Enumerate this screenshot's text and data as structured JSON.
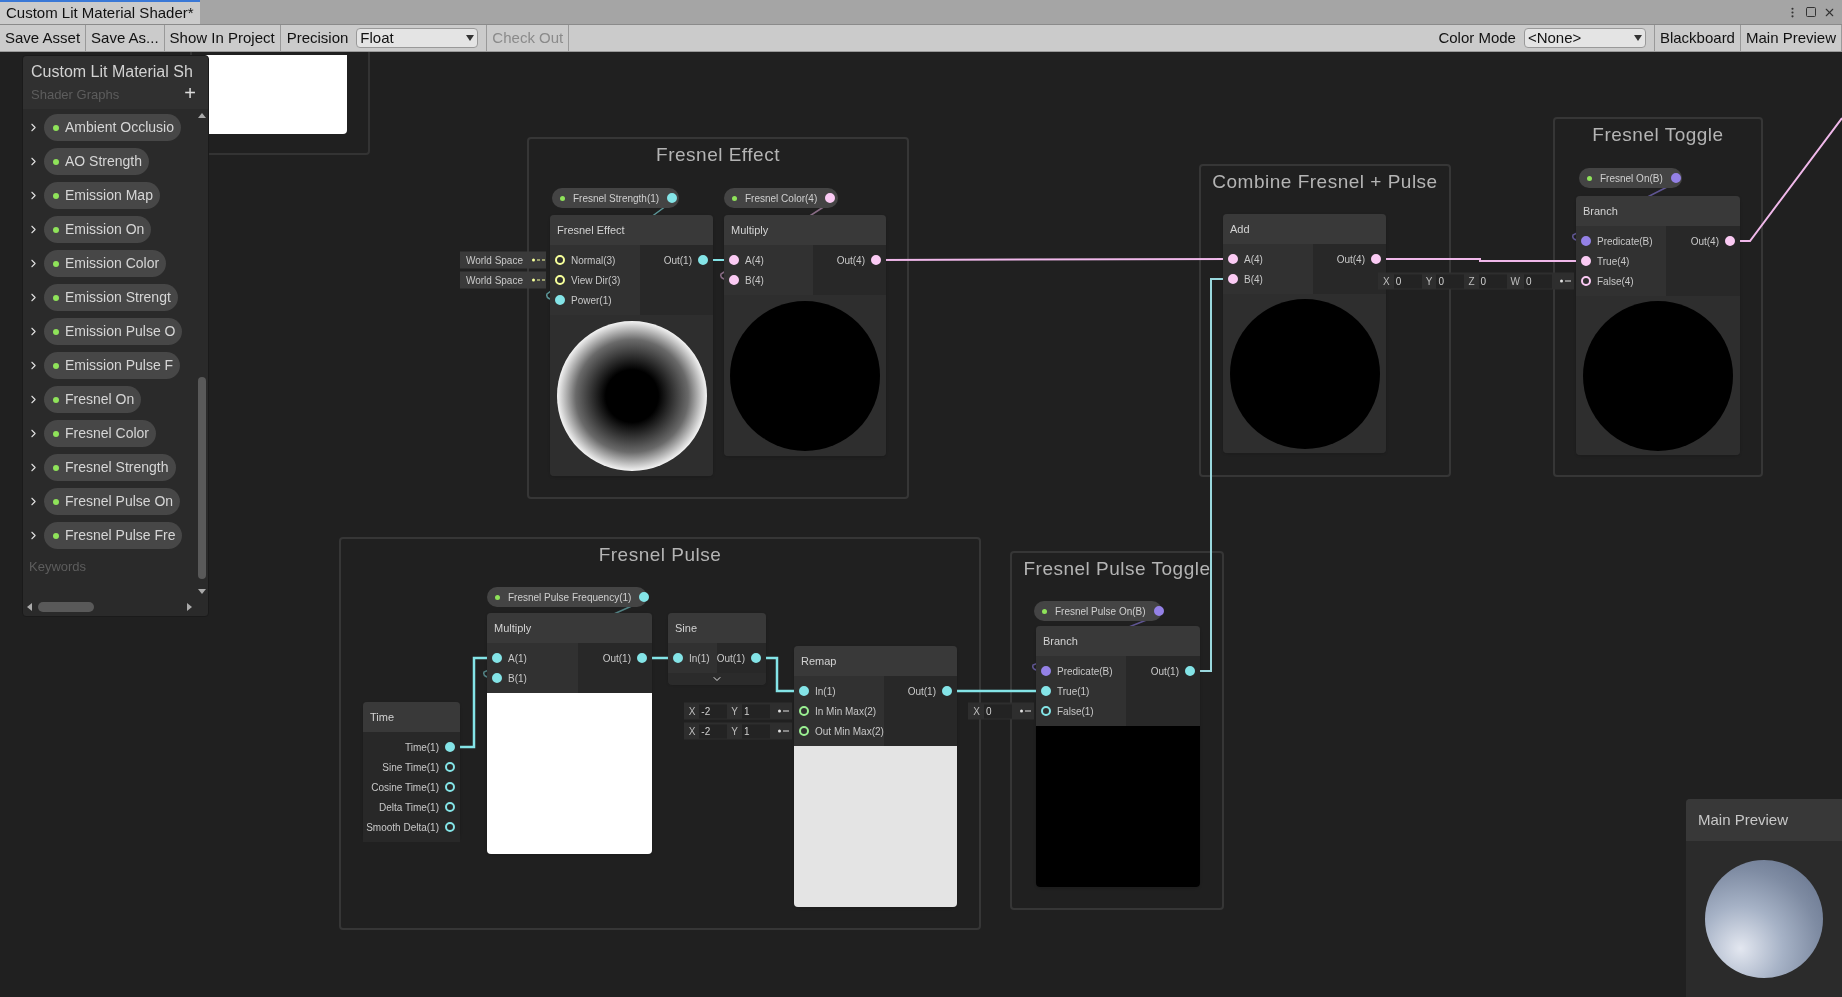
{
  "tab": {
    "title": "Custom Lit Material Shader*",
    "selected": true
  },
  "toolbar": {
    "left": [
      {
        "kind": "button",
        "label": "Save Asset",
        "disabled": false
      },
      {
        "kind": "button",
        "label": "Save As...",
        "disabled": false
      },
      {
        "kind": "button",
        "label": "Show In Project",
        "disabled": false
      },
      {
        "kind": "dropdown",
        "label": "Precision",
        "value": "Float",
        "disabled": false
      },
      {
        "kind": "button",
        "label": "Check Out",
        "disabled": true
      }
    ],
    "right": [
      {
        "kind": "dropdown",
        "label": "Color Mode",
        "value": "<None>",
        "disabled": false
      },
      {
        "kind": "button",
        "label": "Blackboard",
        "disabled": false
      },
      {
        "kind": "button",
        "label": "Main Preview",
        "disabled": false
      }
    ]
  },
  "blackboard": {
    "title": "Custom Lit Material Sh",
    "subtitle": "Shader Graphs",
    "add": "+",
    "section": "Keywords",
    "properties": [
      {
        "name": "Ambient Occlusio",
        "expanded": false
      },
      {
        "name": "AO Strength",
        "expanded": false
      },
      {
        "name": "Emission Map",
        "expanded": false
      },
      {
        "name": "Emission On",
        "expanded": false
      },
      {
        "name": "Emission Color",
        "expanded": false
      },
      {
        "name": "Emission Strengt",
        "expanded": false
      },
      {
        "name": "Emission Pulse O",
        "expanded": false
      },
      {
        "name": "Emission Pulse F",
        "expanded": false
      },
      {
        "name": "Fresnel On",
        "expanded": false
      },
      {
        "name": "Fresnel Color",
        "expanded": false
      },
      {
        "name": "Fresnel Strength",
        "expanded": false
      },
      {
        "name": "Fresnel Pulse On",
        "expanded": false
      },
      {
        "name": "Fresnel Pulse Fre",
        "expanded": false
      }
    ]
  },
  "groups": [
    {
      "title": "Fresnel Effect",
      "nodes": [
        {
          "kind": "property",
          "label": "Fresnel Strength(1)",
          "color": "#84e4e7"
        },
        {
          "kind": "node",
          "title": "Fresnel Effect",
          "preview": {
            "kind": "fresnel"
          },
          "inputs": [
            {
              "label": "Normal(3)",
              "color": "#f6ff9a",
              "connected": false,
              "inline": {
                "kind": "space",
                "label": "World Space"
              }
            },
            {
              "label": "View Dir(3)",
              "color": "#f6ff9a",
              "connected": false,
              "inline": {
                "kind": "space",
                "label": "World Space"
              }
            },
            {
              "label": "Power(1)",
              "color": "#84e4e7",
              "connected": true
            }
          ],
          "outputs": [
            {
              "label": "Out(1)",
              "color": "#84e4e7",
              "connected": true
            }
          ]
        },
        {
          "kind": "property",
          "label": "Fresnel Color(4)",
          "color": "#fbcbf4"
        },
        {
          "kind": "node",
          "title": "Multiply",
          "preview": {
            "kind": "black_sphere"
          },
          "inputs": [
            {
              "label": "A(4)",
              "color": "#fbcbf4",
              "connected": true
            },
            {
              "label": "B(4)",
              "color": "#fbcbf4",
              "connected": true
            }
          ],
          "outputs": [
            {
              "label": "Out(4)",
              "color": "#fbcbf4",
              "connected": true
            }
          ]
        }
      ]
    },
    {
      "title": "Combine Fresnel + Pulse",
      "nodes": [
        {
          "kind": "node",
          "title": "Add",
          "preview": {
            "kind": "black_sphere"
          },
          "inputs": [
            {
              "label": "A(4)",
              "color": "#fbcbf4",
              "connected": true
            },
            {
              "label": "B(4)",
              "color": "#fbcbf4",
              "connected": true
            }
          ],
          "outputs": [
            {
              "label": "Out(4)",
              "color": "#fbcbf4",
              "connected": true
            }
          ]
        }
      ]
    },
    {
      "title": "Fresnel Toggle",
      "nodes": [
        {
          "kind": "property",
          "label": "Fresnel On(B)",
          "color": "#9481e6"
        },
        {
          "kind": "node",
          "title": "Branch",
          "preview": {
            "kind": "black_sphere"
          },
          "inputs": [
            {
              "label": "Predicate(B)",
              "color": "#9481e6",
              "connected": true
            },
            {
              "label": "True(4)",
              "color": "#fbcbf4",
              "connected": true
            },
            {
              "label": "False(4)",
              "color": "#fbcbf4",
              "connected": false,
              "inline": {
                "kind": "vector",
                "fields": [
                  {
                    "axis": "X",
                    "value": "0"
                  },
                  {
                    "axis": "Y",
                    "value": "0"
                  },
                  {
                    "axis": "Z",
                    "value": "0"
                  },
                  {
                    "axis": "W",
                    "value": "0"
                  }
                ]
              }
            }
          ],
          "outputs": [
            {
              "label": "Out(4)",
              "color": "#fbcbf4",
              "connected": true
            }
          ]
        }
      ]
    },
    {
      "title": "Fresnel Pulse",
      "nodes": [
        {
          "kind": "node",
          "title": "Time",
          "outputs": [
            {
              "label": "Time(1)",
              "color": "#84e4e7",
              "connected": true
            },
            {
              "label": "Sine Time(1)",
              "color": "#84e4e7",
              "connected": false
            },
            {
              "label": "Cosine Time(1)",
              "color": "#84e4e7",
              "connected": false
            },
            {
              "label": "Delta Time(1)",
              "color": "#84e4e7",
              "connected": false
            },
            {
              "label": "Smooth Delta(1)",
              "color": "#84e4e7",
              "connected": false
            }
          ]
        },
        {
          "kind": "property",
          "label": "Fresnel Pulse Frequency(1)",
          "color": "#84e4e7"
        },
        {
          "kind": "node",
          "title": "Multiply",
          "preview": {
            "kind": "white"
          },
          "inputs": [
            {
              "label": "A(1)",
              "color": "#84e4e7",
              "connected": true
            },
            {
              "label": "B(1)",
              "color": "#84e4e7",
              "connected": true
            }
          ],
          "outputs": [
            {
              "label": "Out(1)",
              "color": "#84e4e7",
              "connected": true
            }
          ]
        },
        {
          "kind": "node",
          "title": "Sine",
          "preview": {
            "kind": "collapsed"
          },
          "inputs": [
            {
              "label": "In(1)",
              "color": "#84e4e7",
              "connected": true
            }
          ],
          "outputs": [
            {
              "label": "Out(1)",
              "color": "#84e4e7",
              "connected": true
            }
          ]
        },
        {
          "kind": "node",
          "title": "Remap",
          "preview": {
            "kind": "light"
          },
          "inputs": [
            {
              "label": "In(1)",
              "color": "#84e4e7",
              "connected": true
            },
            {
              "label": "In Min Max(2)",
              "color": "#9aef92",
              "connected": false,
              "inline": {
                "kind": "vector",
                "fields": [
                  {
                    "axis": "X",
                    "value": "-2"
                  },
                  {
                    "axis": "Y",
                    "value": "1"
                  }
                ]
              }
            },
            {
              "label": "Out Min Max(2)",
              "color": "#9aef92",
              "connected": false,
              "inline": {
                "kind": "vector",
                "fields": [
                  {
                    "axis": "X",
                    "value": "-2"
                  },
                  {
                    "axis": "Y",
                    "value": "1"
                  }
                ]
              }
            }
          ],
          "outputs": [
            {
              "label": "Out(1)",
              "color": "#84e4e7",
              "connected": true
            }
          ]
        }
      ]
    },
    {
      "title": "Fresnel Pulse Toggle",
      "nodes": [
        {
          "kind": "property",
          "label": "Fresnel Pulse On(B)",
          "color": "#9481e6"
        },
        {
          "kind": "node",
          "title": "Branch",
          "preview": {
            "kind": "black"
          },
          "inputs": [
            {
              "label": "Predicate(B)",
              "color": "#9481e6",
              "connected": true
            },
            {
              "label": "True(1)",
              "color": "#84e4e7",
              "connected": true
            },
            {
              "label": "False(1)",
              "color": "#84e4e7",
              "connected": false,
              "inline": {
                "kind": "vector",
                "fields": [
                  {
                    "axis": "X",
                    "value": "0"
                  }
                ]
              }
            }
          ],
          "outputs": [
            {
              "label": "Out(1)",
              "color": "#84e4e7",
              "connected": true
            }
          ]
        }
      ]
    }
  ],
  "main_preview": {
    "title": "Main Preview"
  }
}
